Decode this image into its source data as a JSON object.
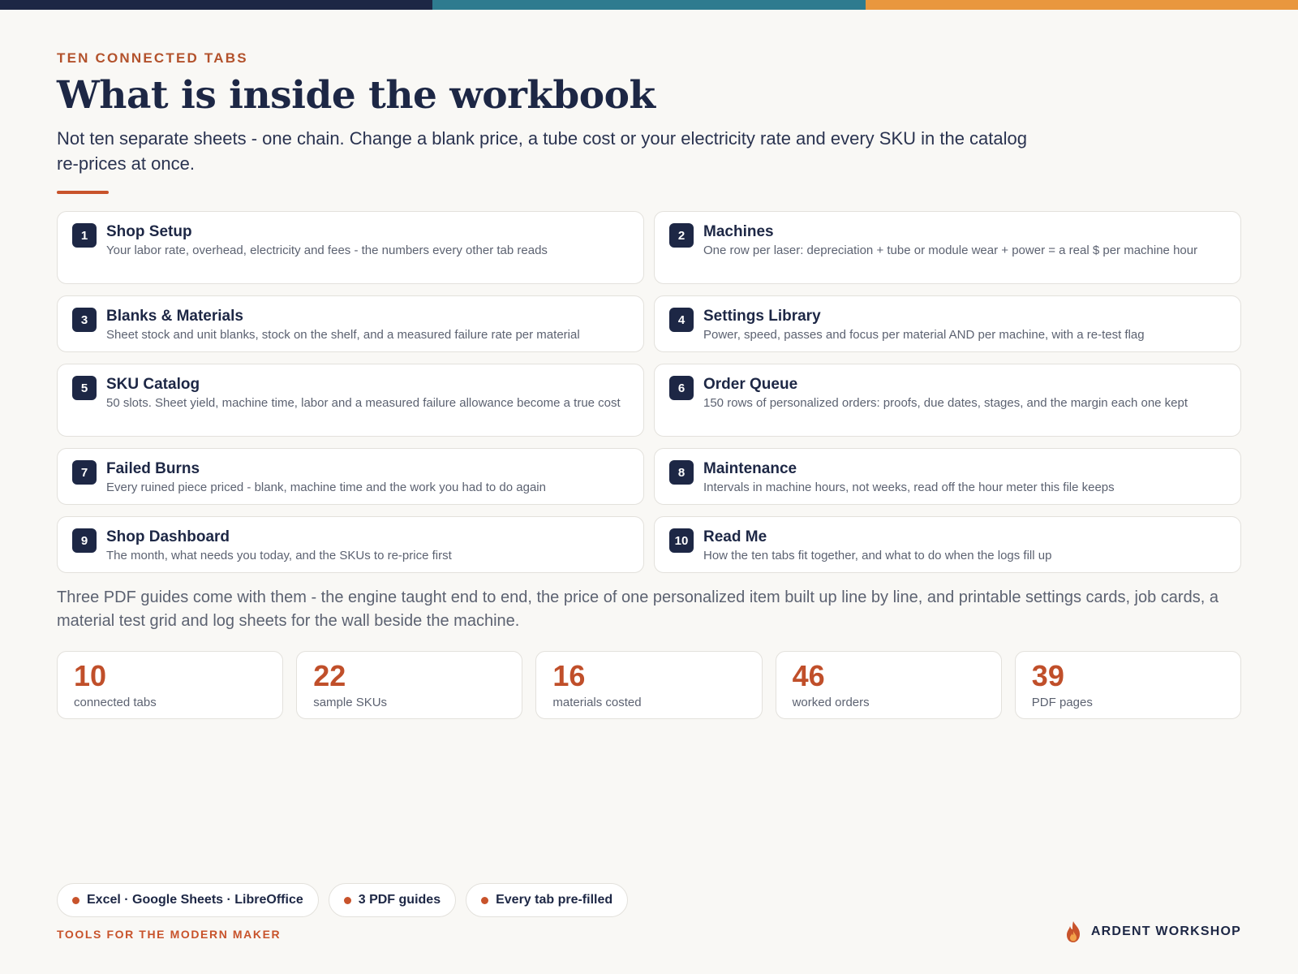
{
  "colors": {
    "navy": "#1d2745",
    "teal": "#2e7b8f",
    "orange": "#e9973e",
    "accent": "#c8532b",
    "background": "#f9f8f5"
  },
  "header": {
    "eyebrow": "TEN CONNECTED TABS",
    "title": "What is inside the workbook",
    "subtitle": "Not ten separate sheets - one chain. Change a blank price, a tube cost or your electricity rate and every SKU in the catalog re-prices at once."
  },
  "tabs": [
    {
      "num": "1",
      "title": "Shop Setup",
      "desc": "Your labor rate, overhead, electricity and fees - the numbers every other tab reads"
    },
    {
      "num": "2",
      "title": "Machines",
      "desc": "One row per laser: depreciation + tube or module wear + power = a real $ per machine hour"
    },
    {
      "num": "3",
      "title": "Blanks & Materials",
      "desc": "Sheet stock and unit blanks, stock on the shelf, and a measured failure rate per material"
    },
    {
      "num": "4",
      "title": "Settings Library",
      "desc": "Power, speed, passes and focus per material AND per machine, with a re-test flag"
    },
    {
      "num": "5",
      "title": "SKU Catalog",
      "desc": "50 slots. Sheet yield, machine time, labor and a measured failure allowance become a true cost"
    },
    {
      "num": "6",
      "title": "Order Queue",
      "desc": "150 rows of personalized orders: proofs, due dates, stages, and the margin each one kept"
    },
    {
      "num": "7",
      "title": "Failed Burns",
      "desc": "Every ruined piece priced - blank, machine time and the work you had to do again"
    },
    {
      "num": "8",
      "title": "Maintenance",
      "desc": "Intervals in machine hours, not weeks, read off the hour meter this file keeps"
    },
    {
      "num": "9",
      "title": "Shop Dashboard",
      "desc": "The month, what needs you today, and the SKUs to re-price first"
    },
    {
      "num": "10",
      "title": "Read Me",
      "desc": "How the ten tabs fit together, and what to do when the logs fill up"
    }
  ],
  "guides_text": "Three PDF guides come with them - the engine taught end to end, the price of one personalized item built up line by line, and printable settings cards, job cards, a material test grid and log sheets for the wall beside the machine.",
  "stats": [
    {
      "value": "10",
      "label": "connected tabs"
    },
    {
      "value": "22",
      "label": "sample SKUs"
    },
    {
      "value": "16",
      "label": "materials costed"
    },
    {
      "value": "46",
      "label": "worked orders"
    },
    {
      "value": "39",
      "label": "PDF pages"
    }
  ],
  "pills": [
    {
      "label": "Excel · Google Sheets · LibreOffice"
    },
    {
      "label": "3 PDF guides"
    },
    {
      "label": "Every tab pre-filled"
    }
  ],
  "footer": {
    "tagline": "TOOLS FOR THE MODERN MAKER",
    "brand": "ARDENT WORKSHOP",
    "brand_icon": "flame-icon"
  }
}
